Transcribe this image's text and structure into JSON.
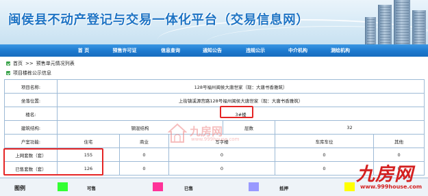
{
  "header": {
    "site_title": "闽侯县不动产登记与交易一体化平台（交易信息网）"
  },
  "nav": {
    "items": [
      "首 页",
      "预售许可证",
      "信息查询",
      "通知公告",
      "违规公示",
      "中介机构",
      "测绘机构"
    ]
  },
  "breadcrumb": {
    "home": "首页",
    "separator": ">>",
    "current": "预售单元情况列表"
  },
  "section": {
    "title": "项目楼栋公示信息"
  },
  "project": {
    "name_label": "项目名称:",
    "name_value": "128号福州闽侯大唐世家（现：大唐书香雅筑）",
    "location_label": "坐落位置:",
    "location_value": "上街镇溪源宫路128号福州闽侯大唐世家（现：大唐书香雅筑）",
    "building_label": "楼名:",
    "building_value": "3#楼",
    "structure_label": "建筑结构:",
    "structure_value": "钢混结构",
    "floors_label": "层数",
    "floors_value": "32",
    "use_label": "户室功能:",
    "uses": [
      "住宅",
      "商业",
      "写字楼",
      "车库车位",
      "其他"
    ],
    "listed_label": "上网套数（套）",
    "listed_values": [
      "155",
      "0",
      "0",
      "0",
      "0"
    ],
    "sold_label": "已售套数（套）",
    "sold_values": [
      "126",
      "0",
      "0",
      "0",
      "0"
    ]
  },
  "legend": {
    "title": "图例",
    "items": [
      {
        "label": "可售",
        "color": "#33ff33"
      },
      {
        "label": "已售",
        "color": "#ff3399"
      },
      {
        "label": "抵押",
        "color": "#9999ff"
      },
      {
        "label": "",
        "color": "#ffff00"
      }
    ]
  },
  "watermarks": {
    "center_brand": "九房网",
    "center_url": "www.999house.com",
    "corner_brand": "九房网",
    "corner_url": "www.999house.com"
  },
  "colors": {
    "nav": "#1e7bd0",
    "title": "#1e74c4",
    "border": "#9dbad6",
    "annotation": "#e52424"
  }
}
